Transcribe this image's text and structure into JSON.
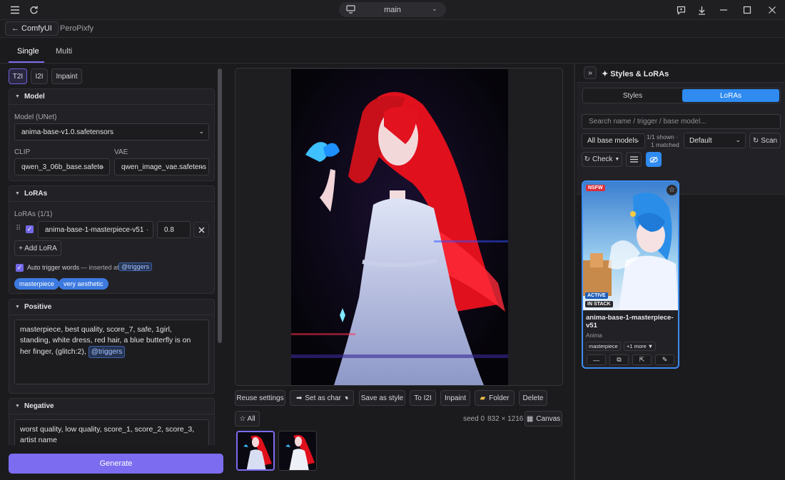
{
  "titlebar": {
    "workspace": "main",
    "icons": [
      "hamburger-icon",
      "refresh-icon",
      "monitor-icon",
      "chat-icon",
      "download-icon",
      "minimize-icon",
      "maximize-icon",
      "close-icon"
    ]
  },
  "crumb": {
    "back_label": "← ComfyUI",
    "sub": "PeroPixfy"
  },
  "mode_tabs": {
    "single": "Single",
    "multi": "Multi"
  },
  "gen_modes": [
    "T2I",
    "I2I",
    "Inpaint"
  ],
  "model": {
    "header": "Model",
    "unet_label": "Model (UNet)",
    "unet_value": "anima-base-v1.0.safetensors",
    "clip_label": "CLIP",
    "clip_value": "qwen_3_06b_base.safete",
    "vae_label": "VAE",
    "vae_value": "qwen_image_vae.safetens"
  },
  "loras": {
    "header": "LoRAs",
    "count_label": "LoRAs (1/1)",
    "item_name": "anima-base-1-masterpiece-v51",
    "item_strength": "0.8",
    "add_label": "+ Add LoRA",
    "auto_label": "Auto trigger words",
    "inserted_label": "— inserted at",
    "inserted_tag": "@triggers",
    "chips": [
      "masterpiece",
      "very aesthetic"
    ]
  },
  "positive": {
    "header": "Positive",
    "text": "masterpiece, best quality, score_7, safe, 1girl, standing, white dress, red hair, a blue butterfly is on her finger, (glitch:2),",
    "tag": "@triggers"
  },
  "negative": {
    "header": "Negative",
    "text": "worst quality, low quality, score_1, score_2, score_3, artist name"
  },
  "generate_label": "Generate",
  "viewer": {
    "actions": [
      "Reuse settings",
      "Set as char",
      "Save as style",
      "To I2I",
      "Inpaint",
      "Folder",
      "Delete"
    ],
    "all_label": "☆ All",
    "seed_label": "seed 0",
    "size_label": "832 × 1216",
    "canvas_label": "Canvas"
  },
  "styles_panel": {
    "title": "✦ Styles & LoRAs",
    "tab_styles": "Styles",
    "tab_loras": "LoRAs",
    "search_placeholder": "Search name / trigger / base model...",
    "base_filter": "All base models",
    "shown_line1": "1/1 shown ·",
    "shown_line2": "1 matched",
    "sort_value": "Default",
    "scan_label": "Scan",
    "check_label": "Check",
    "accent": "#2f8bf0"
  },
  "lora_card": {
    "nsfw": "NSFW",
    "active": "ACTIVE",
    "in_stack": "IN STACK",
    "name": "anima-base-1-masterpiece-v51",
    "base": "Anima",
    "tag1": "masterpiece",
    "more": "+1 more ▼"
  }
}
